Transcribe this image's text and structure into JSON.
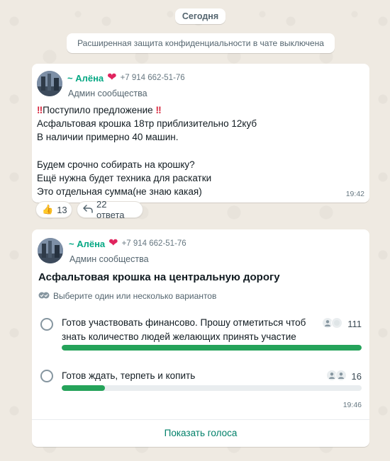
{
  "date_label": "Сегодня",
  "system_notice": "Расширенная защита конфиденциальности в чате выключена",
  "message1": {
    "sender_name": "~ Алёна",
    "heart": "❤",
    "phone": "+7 914 662-51-76",
    "role": "Админ сообщества",
    "bang": "‼",
    "line1": "Поступило предложение",
    "lines": [
      "Асфальтовая крошка 18тр приблизительно 12куб",
      "В наличии примерно 40 машин.",
      "",
      "Будем срочно собирать на крошку?",
      "Ещё нужна будет техника для раскатки",
      "Это отдельная сумма(не знаю какая)"
    ],
    "time": "19:42",
    "reaction_emoji": "👍",
    "reaction_count": "13",
    "replies_label": "22 ответа"
  },
  "message2": {
    "sender_name": "~ Алёна",
    "heart": "❤",
    "phone": "+7 914 662-51-76",
    "role": "Админ сообщества",
    "poll_title": "Асфальтовая крошка на центральную дорогу",
    "poll_hint": "Выберите один или несколько вариантов",
    "options": [
      {
        "line1": "Готов участвовать финансово. Прошу отметиться чтоб",
        "line2": "знать количество людей желающих принять участие",
        "votes": "111",
        "fraction": 1.0
      },
      {
        "line1": "Готов ждать, терпеть и копить",
        "line2": "",
        "votes": "16",
        "fraction": 0.144
      }
    ],
    "time": "19:46",
    "show_votes": "Показать голоса"
  },
  "colors": {
    "accent": "#25a35a",
    "sender": "#06a884",
    "link": "#008069"
  }
}
